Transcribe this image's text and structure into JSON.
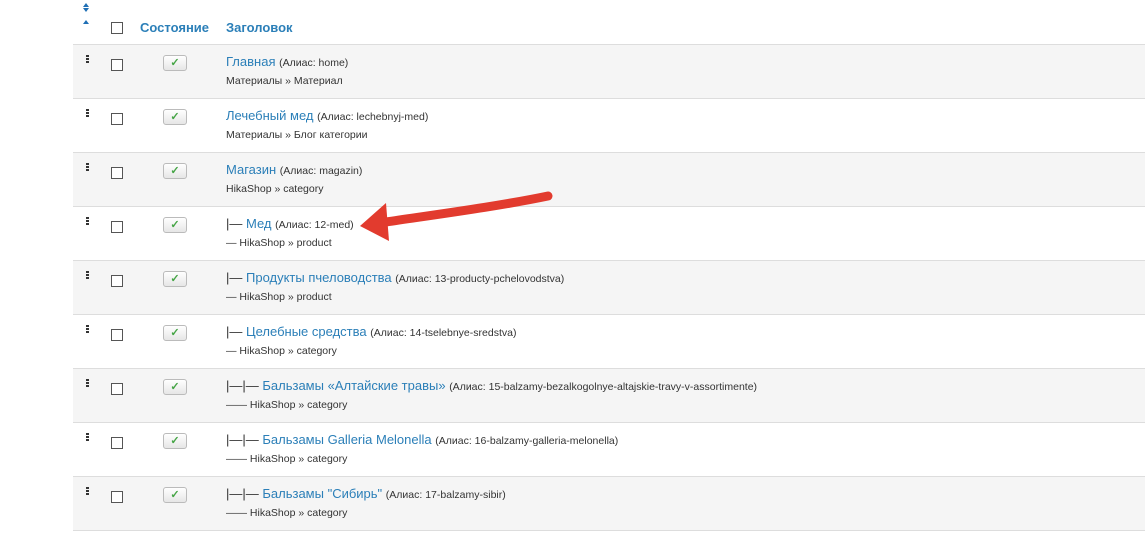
{
  "header": {
    "state_label": "Состояние",
    "title_label": "Заголовок"
  },
  "rows": [
    {
      "prefix": "",
      "title": "Главная",
      "alias": "(Алиас: home)",
      "type": "Материалы » Материал"
    },
    {
      "prefix": "",
      "title": "Лечебный мед",
      "alias": "(Алиас: lechebnyj-med)",
      "type": "Материалы » Блог категории"
    },
    {
      "prefix": "",
      "title": "Магазин",
      "alias": "(Алиас: magazin)",
      "type": "HikaShop » category"
    },
    {
      "prefix": "|— ",
      "title": "Мед",
      "alias": "(Алиас: 12-med)",
      "type": "— HikaShop » product"
    },
    {
      "prefix": "|— ",
      "title": "Продукты пчеловодства",
      "alias": "(Алиас: 13-producty-pchelovodstva)",
      "type": "— HikaShop » product"
    },
    {
      "prefix": "|— ",
      "title": "Целебные средства",
      "alias": "(Алиас: 14-tselebnye-sredstva)",
      "type": "— HikaShop » category"
    },
    {
      "prefix": "|—|— ",
      "title": "Бальзамы «Алтайские травы»",
      "alias": "(Алиас: 15-balzamy-bezalkogolnye-altajskie-travy-v-assortimente)",
      "type": "—— HikaShop » category"
    },
    {
      "prefix": "|—|— ",
      "title": "Бальзамы Galleria Melonella",
      "alias": "(Алиас: 16-balzamy-galleria-melonella)",
      "type": "—— HikaShop » category"
    },
    {
      "prefix": "|—|— ",
      "title": "Бальзамы \"Сибирь\"",
      "alias": "(Алиас: 17-balzamy-sibir)",
      "type": "—— HikaShop » category"
    }
  ],
  "colors": {
    "link": "#2b7fb8",
    "state_check": "#46a546",
    "arrow": "#e23b2e"
  }
}
